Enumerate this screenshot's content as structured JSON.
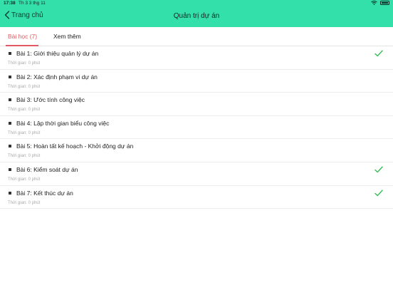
{
  "status_bar": {
    "time": "17:38",
    "date": "Th 3 3 thg 11"
  },
  "nav": {
    "back_label": "Trang chủ",
    "title": "Quản trị dự án"
  },
  "tabs": [
    {
      "label": "Bài học (7)",
      "active": true
    },
    {
      "label": "Xem thêm",
      "active": false
    }
  ],
  "colors": {
    "header": "#33e0aa",
    "accent": "#e05a63",
    "check": "#3bbf5a"
  },
  "lessons": [
    {
      "title": "Bài 1: Giới thiệu quản lý dự án",
      "time": "Thời gian: 0 phút",
      "completed": true
    },
    {
      "title": "Bài 2: Xác định phạm vi dự án",
      "time": "Thời gian: 0 phút",
      "completed": false
    },
    {
      "title": "Bài 3: Ước tính công việc",
      "time": "Thời gian: 0 phút",
      "completed": false
    },
    {
      "title": "Bài 4: Lập thời gian biểu công việc",
      "time": "Thời gian: 0 phút",
      "completed": false
    },
    {
      "title": "Bài 5: Hoàn tất kế hoạch - Khởi động dự án",
      "time": "Thời gian: 0 phút",
      "completed": false
    },
    {
      "title": "Bài 6: Kiểm soát dự án",
      "time": "Thời gian: 0 phút",
      "completed": true
    },
    {
      "title": "Bài 7: Kết thúc dự án",
      "time": "Thời gian: 0 phút",
      "completed": true
    }
  ]
}
